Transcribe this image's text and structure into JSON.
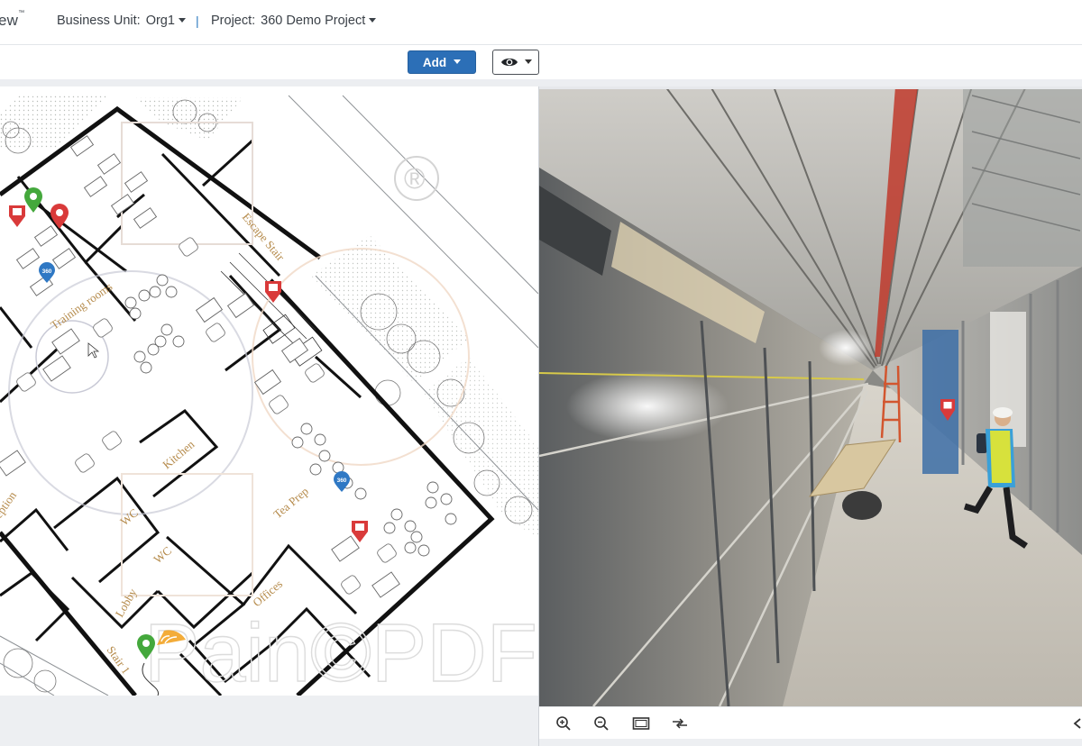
{
  "header": {
    "brand": "ew",
    "brand_mark": "™",
    "business_unit_label": "Business Unit:",
    "business_unit_value": "Org1",
    "separator": "|",
    "project_label": "Project:",
    "project_value": "360 Demo Project"
  },
  "toolbar": {
    "add_label": "Add",
    "view_icon": "eye-icon"
  },
  "floorplan": {
    "room_labels": [
      "Training rooms",
      "Escape Stair",
      "Kitchen",
      "Tea Prep",
      "WC",
      "WC",
      "Offices",
      "Lobby",
      "Stair 1",
      "eption"
    ],
    "watermark": "Pain©PDF",
    "registered_mark": "®",
    "marker_badge": "360",
    "marker_colors": {
      "red": "#d93a3a",
      "green": "#44a83c",
      "blue": "#2f78c4",
      "orange": "#f2a324"
    }
  },
  "viewer": {
    "tools": [
      "zoom-in-icon",
      "zoom-out-icon",
      "fit-screen-icon",
      "compare-icon",
      "previous-icon"
    ]
  }
}
